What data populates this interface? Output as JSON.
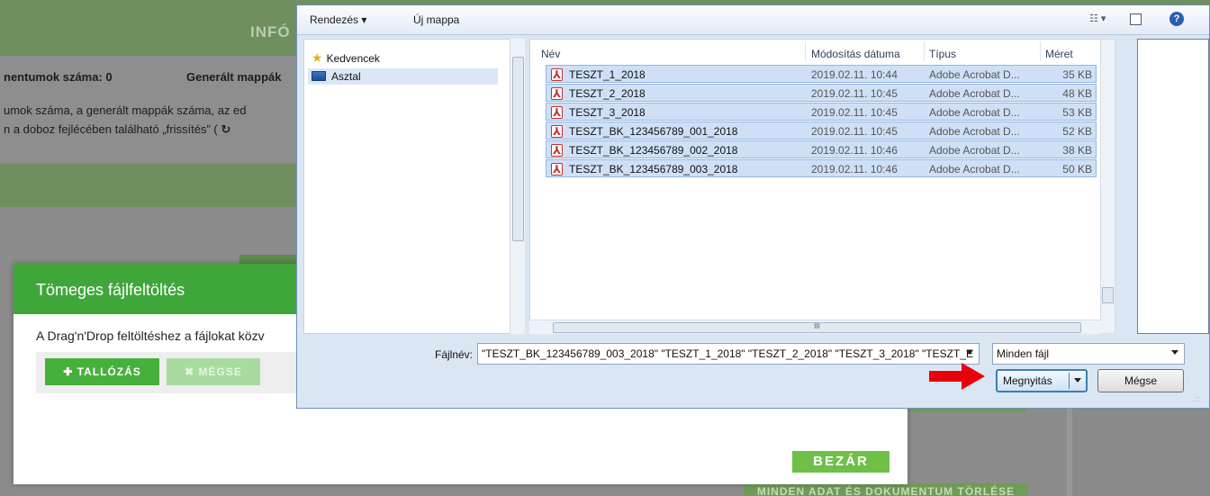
{
  "background": {
    "header_title": "INFÓ",
    "stat_documents": "nentumok száma: 0",
    "stat_folders": "Generált mappák",
    "info_line1": "umok száma, a generált mappák száma, az ed",
    "info_line2": "n a doboz fejlécében található „frissítés” (",
    "refresh_glyph": "↻",
    "bottom_button": "MINDEN ADAT ÉS DOKUMENTUM TÖRLÉSE"
  },
  "upload_modal": {
    "title": "Tömeges fájlfeltöltés",
    "description": "A Drag'n'Drop feltöltéshez a fájlokat közv",
    "browse_label": "✚ TALLÓZÁS",
    "cancel_label": "✖ MÉGSE",
    "close_label": "BEZÁR"
  },
  "file_dialog": {
    "toolbar": {
      "organize": "Rendezés ▾",
      "new_folder": "Új mappa",
      "views": "☷ ▾",
      "help": "?"
    },
    "nav": {
      "favorites": "Kedvencek",
      "desktop": "Asztal"
    },
    "columns": {
      "name": "Név",
      "modified": "Módosítás dátuma",
      "type": "Típus",
      "size": "Méret"
    },
    "files": [
      {
        "name": "TESZT_1_2018",
        "modified": "2019.02.11. 10:44",
        "type": "Adobe Acrobat D...",
        "size": "35 KB"
      },
      {
        "name": "TESZT_2_2018",
        "modified": "2019.02.11. 10:45",
        "type": "Adobe Acrobat D...",
        "size": "48 KB"
      },
      {
        "name": "TESZT_3_2018",
        "modified": "2019.02.11. 10:45",
        "type": "Adobe Acrobat D...",
        "size": "53 KB"
      },
      {
        "name": "TESZT_BK_123456789_001_2018",
        "modified": "2019.02.11. 10:45",
        "type": "Adobe Acrobat D...",
        "size": "52 KB"
      },
      {
        "name": "TESZT_BK_123456789_002_2018",
        "modified": "2019.02.11. 10:46",
        "type": "Adobe Acrobat D...",
        "size": "38 KB"
      },
      {
        "name": "TESZT_BK_123456789_003_2018",
        "modified": "2019.02.11. 10:46",
        "type": "Adobe Acrobat D...",
        "size": "50 KB"
      }
    ],
    "hscroll_grip": "III",
    "filename_label": "Fájlnév:",
    "filename_value": "\"TESZT_BK_123456789_003_2018\" \"TESZT_1_2018\" \"TESZT_2_2018\" \"TESZT_3_2018\" \"TESZT_E",
    "filter_value": "Minden fájl",
    "open_label": "Megnyitás",
    "cancel_label": "Mégse"
  },
  "colors": {
    "modal_green": "#3fa73a",
    "selection_blue": "#cfe0f6",
    "arrow_red": "#e8000b"
  }
}
